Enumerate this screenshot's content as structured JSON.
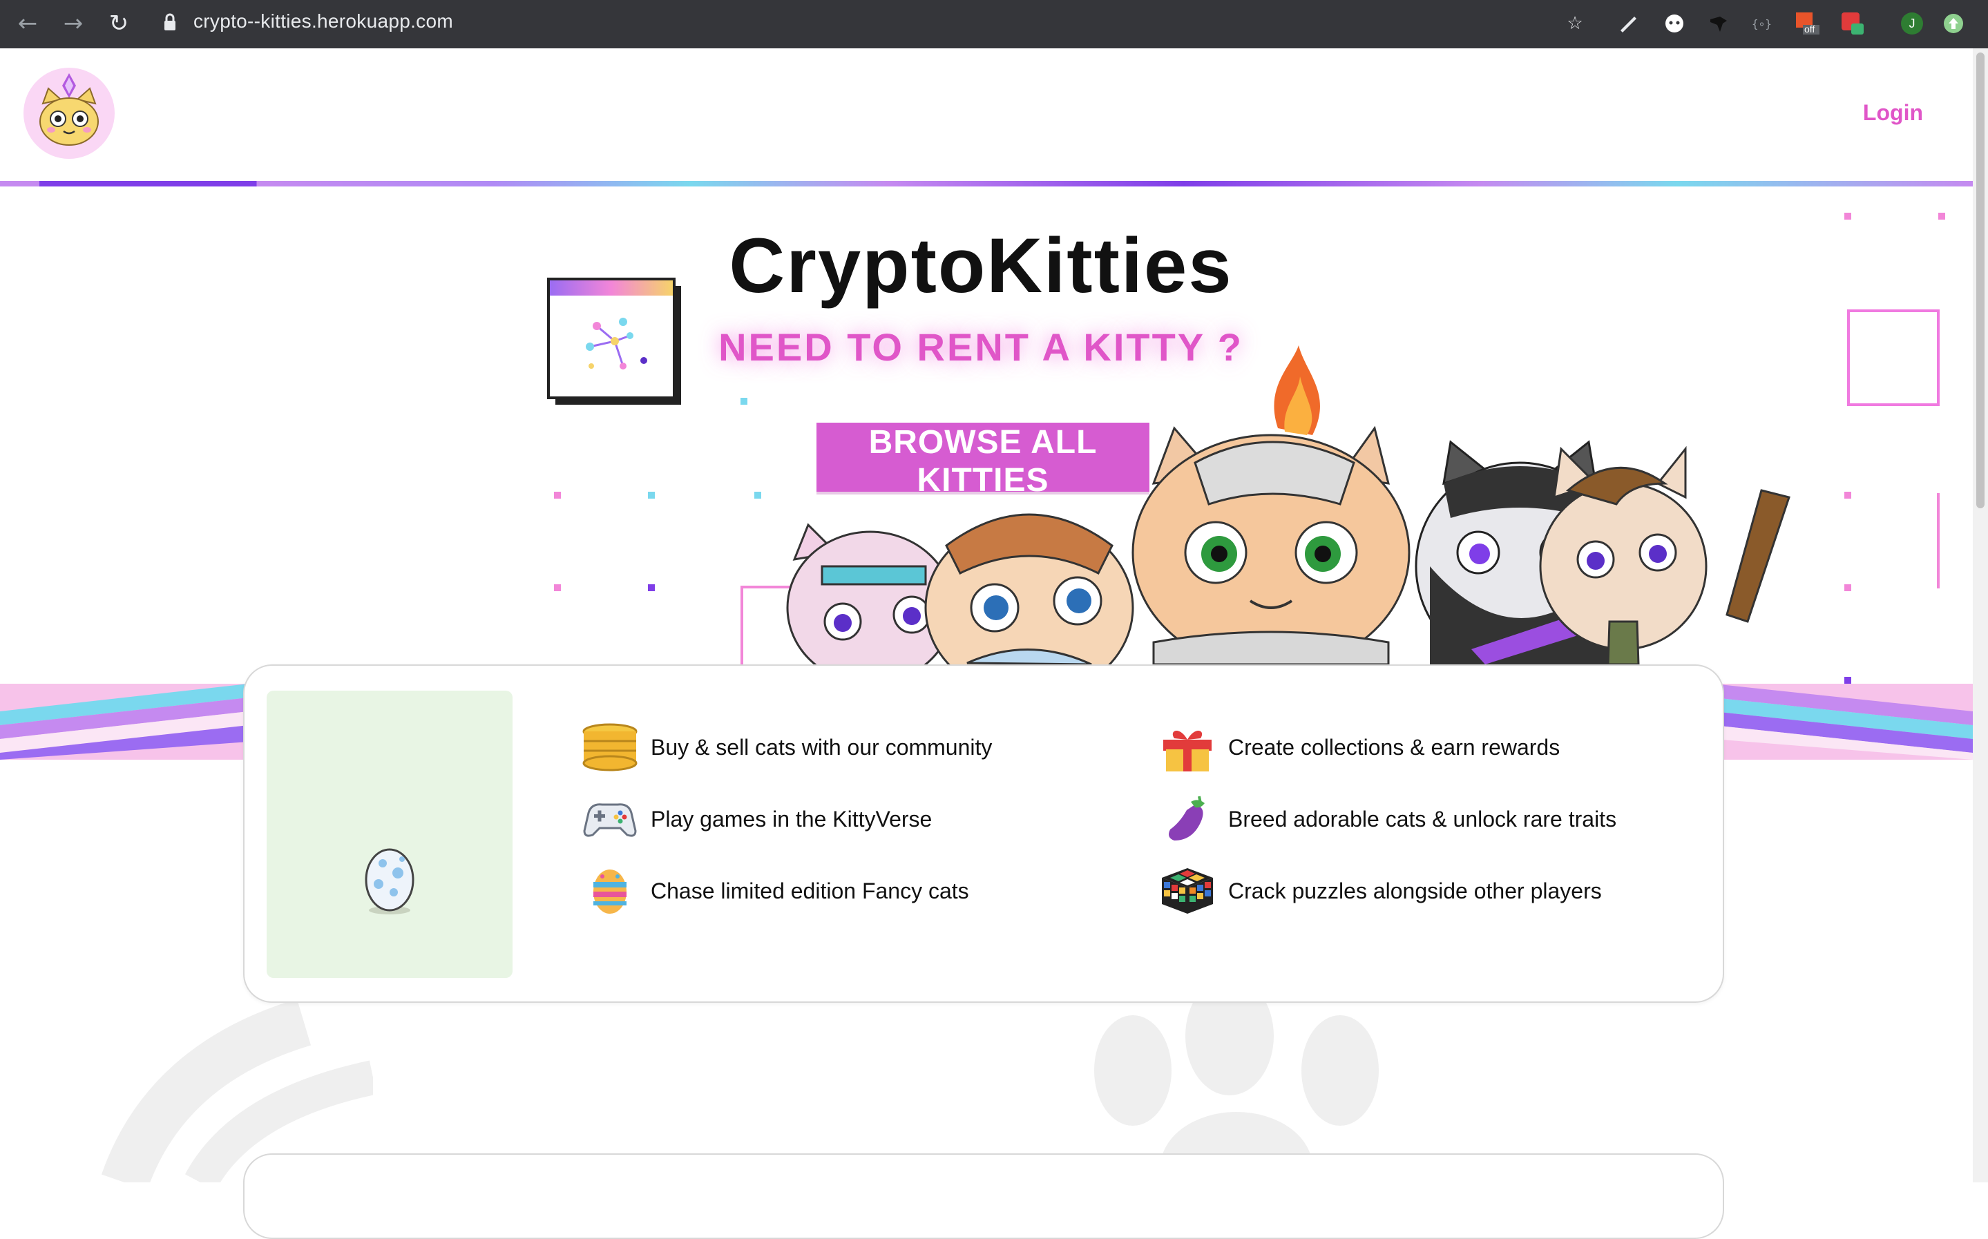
{
  "browser": {
    "back_icon": "←",
    "forward_icon": "→",
    "reload_icon": "↻",
    "url": "crypto--kitties.herokuapp.com",
    "star_icon": "☆",
    "profile_initial": "J",
    "ext_badge": "off"
  },
  "header": {
    "login_label": "Login"
  },
  "hero": {
    "title": "CryptoKitties",
    "subtitle": "NEED TO RENT A KITTY ?",
    "cta_label": "BROWSE ALL KITTIES"
  },
  "features": [
    {
      "icon": "coins-icon",
      "text": "Buy & sell cats with our community"
    },
    {
      "icon": "gift-icon",
      "text": "Create collections & earn rewards"
    },
    {
      "icon": "gamepad-icon",
      "text": "Play games in the KittyVerse"
    },
    {
      "icon": "eggplant-icon",
      "text": "Breed adorable cats & unlock rare traits"
    },
    {
      "icon": "easter-egg-icon",
      "text": "Chase limited edition Fancy cats"
    },
    {
      "icon": "rubiks-cube-icon",
      "text": "Crack puzzles alongside other players"
    }
  ],
  "colors": {
    "accent": "#e056c8",
    "button": "#d65cd1",
    "chrome": "#35363a",
    "panel": "#e8f5e4"
  }
}
